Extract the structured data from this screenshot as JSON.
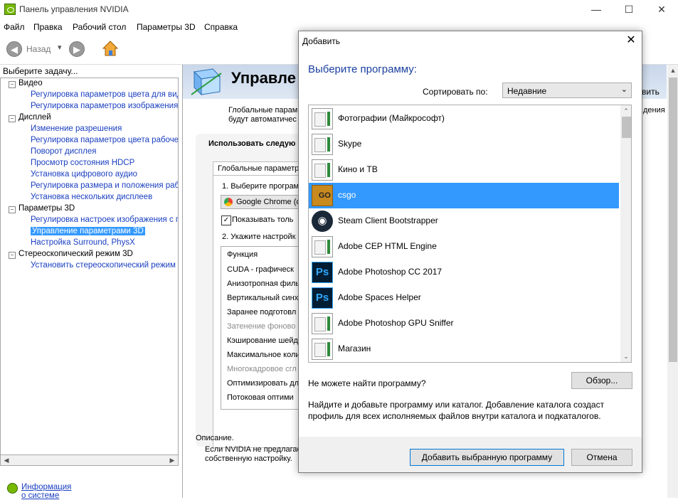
{
  "window": {
    "title": "Панель управления NVIDIA",
    "controls": [
      "—",
      "☐",
      "✕"
    ]
  },
  "menu": [
    "Файл",
    "Правка",
    "Рабочий стол",
    "Параметры 3D",
    "Справка"
  ],
  "toolbar": {
    "back_label": "Назад",
    "back_arrow": "◀",
    "forward_arrow": "▶",
    "dropdown_arrow": "▾"
  },
  "left": {
    "task_label": "Выберите задачу...",
    "tree": [
      {
        "type": "head",
        "label": "Видео",
        "exp": "−"
      },
      {
        "type": "link",
        "label": "Регулировка параметров цвета для вид"
      },
      {
        "type": "link",
        "label": "Регулировка параметров изображения д"
      },
      {
        "type": "head",
        "label": "Дисплей",
        "exp": "−"
      },
      {
        "type": "link",
        "label": "Изменение разрешения"
      },
      {
        "type": "link",
        "label": "Регулировка параметров цвета рабочег"
      },
      {
        "type": "link",
        "label": "Поворот дисплея"
      },
      {
        "type": "link",
        "label": "Просмотр состояния HDCP"
      },
      {
        "type": "link",
        "label": "Установка цифрового аудио"
      },
      {
        "type": "link",
        "label": "Регулировка размера и положения рабо"
      },
      {
        "type": "link",
        "label": "Установка нескольких дисплеев"
      },
      {
        "type": "head",
        "label": "Параметры 3D",
        "exp": "−"
      },
      {
        "type": "link",
        "label": "Регулировка настроек изображения с пр"
      },
      {
        "type": "sel",
        "label": "Управление параметрами 3D"
      },
      {
        "type": "link",
        "label": "Настройка Surround, PhysX"
      },
      {
        "type": "head",
        "label": "Стереоскопический режим 3D",
        "exp": "−"
      },
      {
        "type": "link",
        "label": "Установить стереоскопический режим 3"
      }
    ],
    "system_info": "Информация о системе"
  },
  "right": {
    "banner_title": "Управле",
    "banner_suffix": "вить",
    "desc_lines": [
      "Глобальные парам",
      "будут автоматичес"
    ],
    "desc_right": "дения",
    "section_title": "Использовать следую",
    "tab_label": "Глобальные параметр",
    "step1": "1. Выберите програм",
    "program_select": "Google Chrome (c",
    "checkbox_label": "Показывать толь",
    "step2": "2. Укажите настройк",
    "func_header": "Функция",
    "functions": [
      {
        "label": "CUDA - графическ",
        "disabled": false
      },
      {
        "label": "Анизотропная филь",
        "disabled": false
      },
      {
        "label": "Вертикальный синх",
        "disabled": false
      },
      {
        "label": "Заранее подготовл",
        "disabled": false
      },
      {
        "label": "Затенение фоново",
        "disabled": true
      },
      {
        "label": "Кэширование шейд",
        "disabled": false
      },
      {
        "label": "Максимальное коли",
        "disabled": false
      },
      {
        "label": "Многокадровое сгл",
        "disabled": true
      },
      {
        "label": "Оптимизировать дл",
        "disabled": false
      },
      {
        "label": "Потоковая оптими",
        "disabled": false
      }
    ],
    "description_label": "Описание.",
    "description_lines": [
      "Если NVIDIA не предлагае",
      "собственную настройку."
    ]
  },
  "dialog": {
    "title": "Добавить",
    "close": "✕",
    "heading": "Выберите программу:",
    "sort_label": "Сортировать по:",
    "sort_value": "Недавние",
    "programs": [
      {
        "name": "Фотографии (Майкрософт)",
        "icon": "generic"
      },
      {
        "name": "Skype",
        "icon": "generic"
      },
      {
        "name": "Кино и ТВ",
        "icon": "generic"
      },
      {
        "name": "csgo",
        "icon": "csgo",
        "selected": true
      },
      {
        "name": "Steam Client Bootstrapper",
        "icon": "steam"
      },
      {
        "name": "Adobe CEP HTML Engine",
        "icon": "generic"
      },
      {
        "name": "Adobe Photoshop CC 2017",
        "icon": "ps"
      },
      {
        "name": "Adobe Spaces Helper",
        "icon": "ps"
      },
      {
        "name": "Adobe Photoshop GPU Sniffer",
        "icon": "generic"
      },
      {
        "name": "Магазин",
        "icon": "generic"
      }
    ],
    "cant_find": "Не можете найти программу?",
    "browse": "Обзор...",
    "hint": "Найдите и добавьте программу или каталог. Добавление каталога создаст профиль для всех исполняемых файлов внутри каталога и подкаталогов.",
    "add_button": "Добавить выбранную программу",
    "cancel_button": "Отмена"
  }
}
